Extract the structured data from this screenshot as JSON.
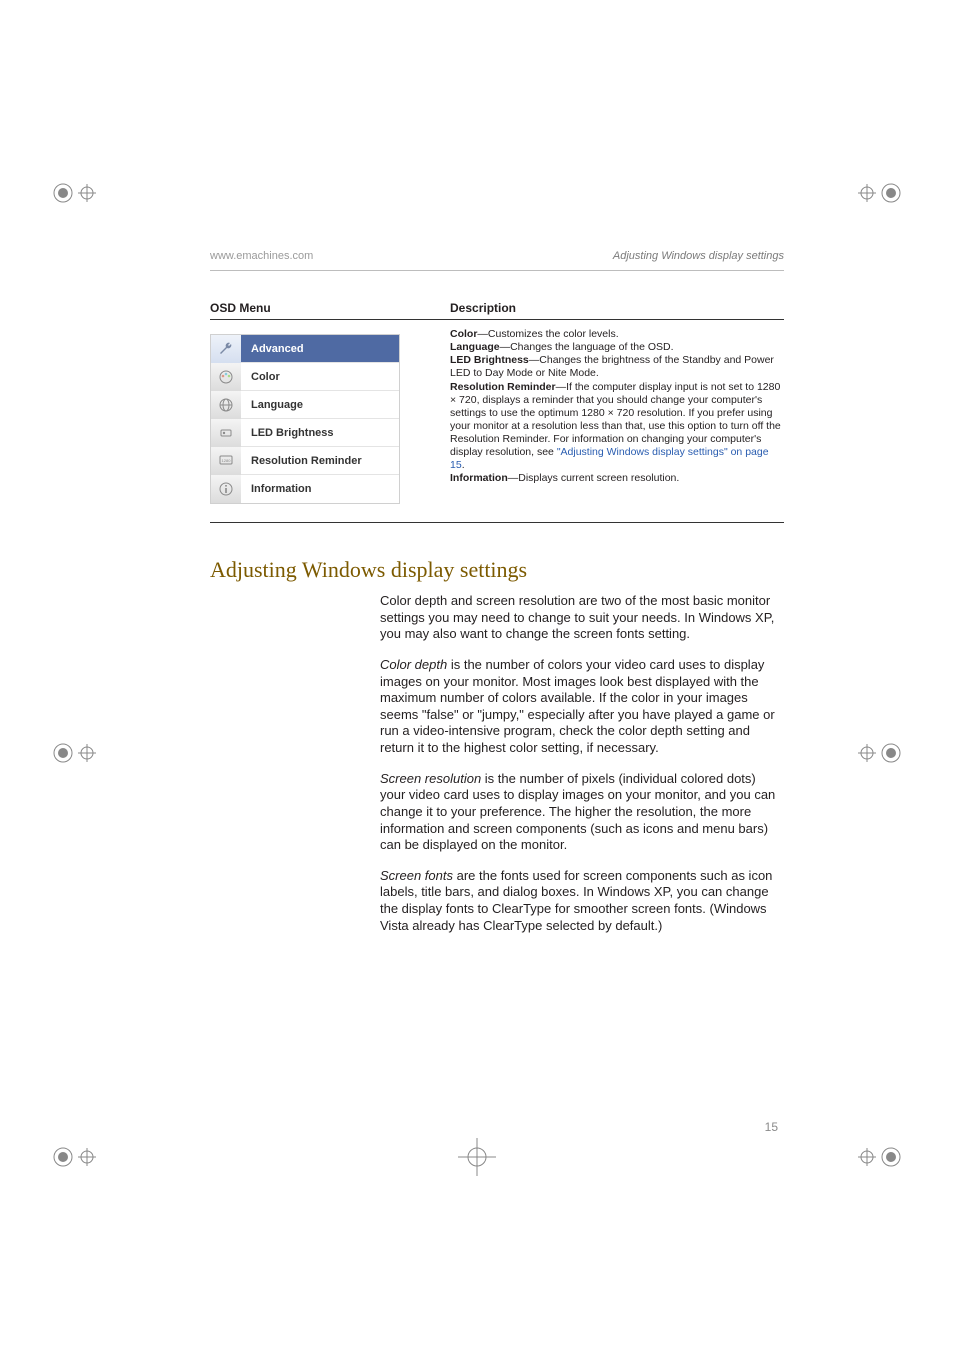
{
  "header": {
    "left": "www.emachines.com",
    "right": "Adjusting Windows display settings"
  },
  "table": {
    "head_a": "OSD Menu",
    "head_b": "Description",
    "osd_items": {
      "advanced": "Advanced",
      "color": "Color",
      "language": "Language",
      "led": "LED Brightness",
      "resrem": "Resolution Reminder",
      "info": "Information"
    },
    "desc": {
      "color_term": "Color",
      "color_txt": "—Customizes the color levels.",
      "lang_term": "Language",
      "lang_txt": "—Changes the language of the OSD.",
      "led_term": "LED Brightness",
      "led_txt": "—Changes the brightness of the Standby and Power LED to Day Mode or Nite Mode.",
      "res_term": "Resolution Reminder",
      "res_txt_a": "—If the computer display input is not set to 1280 × 720, displays a reminder that you should change your computer's settings to use the optimum 1280 × 720 resolution. If you prefer using your monitor at a resolution less than that, use this option to turn off the Resolution Reminder. For information on changing your computer's display resolution, see ",
      "res_link": "\"Adjusting Windows display settings\" on page 15",
      "res_txt_b": ".",
      "info_term": "Information",
      "info_txt": "—Displays current screen resolution."
    }
  },
  "heading": "Adjusting Windows display settings",
  "paras": {
    "p1": "Color depth and screen resolution are two of the most basic monitor settings you may need to change to suit your needs. In Windows XP, you may also want to change the screen fonts setting.",
    "p2a": "Color depth",
    "p2b": " is the number of colors your video card uses to display images on your monitor. Most images look best displayed with the maximum number of colors available. If the color in your images seems \"false\" or \"jumpy,\" especially after you have played a game or run a video-intensive program, check the color depth setting and return it to the highest color setting, if necessary.",
    "p3a": "Screen resolution",
    "p3b": " is the number of pixels (individual colored dots) your video card uses to display images on your monitor, and you can change it to your preference. The higher the resolution, the more information and screen components (such as icons and menu bars) can be displayed on the monitor.",
    "p4a": "Screen fonts",
    "p4b": " are the fonts used for screen components such as icon labels, title bars, and dialog boxes. In Windows XP, you can change the display fonts to ClearType for smoother screen fonts. (Windows Vista already has ClearType selected by default.)",
    "pagenum": "15"
  }
}
